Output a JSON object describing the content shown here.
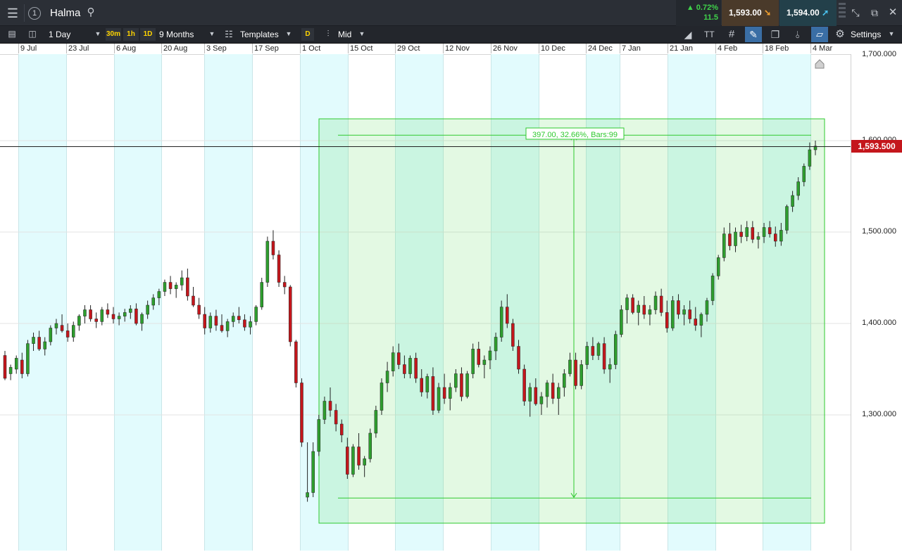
{
  "header": {
    "instrument": "Halma",
    "change_pct": "▲ 0.72%",
    "change_abs": "11.5",
    "sell_price": "1,593.00",
    "buy_price": "1,594.00",
    "sell_arrow": "➘",
    "buy_arrow": "➚"
  },
  "toolbar": {
    "interval": "1 Day",
    "quick_intervals": [
      "30m",
      "1h",
      "1D"
    ],
    "range": "9 Months",
    "templates": "Templates",
    "price_type_badge": "D",
    "price_type": "Mid",
    "font_tool": "TT",
    "settings": "Settings"
  },
  "x_axis": {
    "dates": [
      "9 Jul",
      "23 Jul",
      "6 Aug",
      "20 Aug",
      "3 Sep",
      "17 Sep",
      "1 Oct",
      "15 Oct",
      "29 Oct",
      "12 Nov",
      "26 Nov",
      "10 Dec",
      "24 Dec",
      "7 Jan",
      "21 Jan",
      "4 Feb",
      "18 Feb",
      "4 Mar"
    ]
  },
  "y_axis": {
    "labels": [
      "1,700.000",
      "1,600.000",
      "1,500.000",
      "1,400.000",
      "1,300.000"
    ],
    "values": [
      1700,
      1600,
      1500,
      1400,
      1300
    ],
    "current_price": "1,593.500",
    "current_value": 1593.5
  },
  "measure": {
    "label": "397.00, 32.66%, Bars:99",
    "from_price": 1209,
    "to_price": 1606
  },
  "chart_data": {
    "type": "candlestick",
    "up_color": "#2e9e2e",
    "down_color": "#c4161c",
    "x_labels": [
      "9 Jul",
      "23 Jul",
      "6 Aug",
      "20 Aug",
      "3 Sep",
      "17 Sep",
      "1 Oct",
      "15 Oct",
      "29 Oct",
      "12 Nov",
      "26 Nov",
      "10 Dec",
      "24 Dec",
      "7 Jan",
      "21 Jan",
      "4 Feb",
      "18 Feb",
      "4 Mar"
    ],
    "y_range": [
      1150,
      1700
    ],
    "series": [
      {
        "values_ohlc": [
          [
            1365,
            1370,
            1338,
            1340
          ],
          [
            1345,
            1355,
            1338,
            1352
          ],
          [
            1350,
            1365,
            1345,
            1362
          ],
          [
            1360,
            1368,
            1340,
            1345
          ],
          [
            1345,
            1382,
            1342,
            1378
          ],
          [
            1378,
            1390,
            1370,
            1385
          ],
          [
            1385,
            1392,
            1370,
            1372
          ],
          [
            1372,
            1385,
            1365,
            1380
          ],
          [
            1380,
            1398,
            1376,
            1395
          ],
          [
            1395,
            1405,
            1388,
            1400
          ],
          [
            1398,
            1410,
            1390,
            1392
          ],
          [
            1392,
            1400,
            1380,
            1385
          ],
          [
            1385,
            1402,
            1380,
            1398
          ],
          [
            1398,
            1410,
            1392,
            1408
          ],
          [
            1408,
            1420,
            1400,
            1415
          ],
          [
            1415,
            1420,
            1402,
            1405
          ],
          [
            1405,
            1412,
            1395,
            1402
          ],
          [
            1402,
            1418,
            1398,
            1415
          ],
          [
            1415,
            1422,
            1406,
            1410
          ],
          [
            1410,
            1418,
            1400,
            1405
          ],
          [
            1405,
            1412,
            1398,
            1408
          ],
          [
            1408,
            1416,
            1402,
            1412
          ],
          [
            1412,
            1420,
            1405,
            1416
          ],
          [
            1416,
            1422,
            1398,
            1400
          ],
          [
            1400,
            1412,
            1392,
            1410
          ],
          [
            1410,
            1425,
            1405,
            1420
          ],
          [
            1420,
            1432,
            1415,
            1428
          ],
          [
            1428,
            1438,
            1420,
            1435
          ],
          [
            1435,
            1448,
            1430,
            1445
          ],
          [
            1445,
            1452,
            1432,
            1438
          ],
          [
            1438,
            1445,
            1428,
            1442
          ],
          [
            1442,
            1458,
            1436,
            1450
          ],
          [
            1450,
            1460,
            1425,
            1430
          ],
          [
            1430,
            1440,
            1418,
            1420
          ],
          [
            1420,
            1428,
            1405,
            1410
          ],
          [
            1410,
            1418,
            1388,
            1395
          ],
          [
            1395,
            1412,
            1390,
            1408
          ],
          [
            1408,
            1415,
            1392,
            1398
          ],
          [
            1398,
            1410,
            1390,
            1392
          ],
          [
            1392,
            1405,
            1385,
            1402
          ],
          [
            1402,
            1412,
            1396,
            1408
          ],
          [
            1408,
            1418,
            1400,
            1404
          ],
          [
            1404,
            1410,
            1392,
            1396
          ],
          [
            1396,
            1408,
            1388,
            1402
          ],
          [
            1402,
            1420,
            1398,
            1418
          ],
          [
            1418,
            1450,
            1415,
            1445
          ],
          [
            1445,
            1495,
            1440,
            1490
          ],
          [
            1490,
            1502,
            1470,
            1475
          ],
          [
            1475,
            1480,
            1440,
            1445
          ],
          [
            1445,
            1452,
            1432,
            1440
          ],
          [
            1440,
            1442,
            1375,
            1380
          ],
          [
            1380,
            1382,
            1330,
            1335
          ],
          [
            1335,
            1340,
            1265,
            1270
          ],
          [
            1210,
            1270,
            1205,
            1215
          ],
          [
            1215,
            1270,
            1210,
            1260
          ],
          [
            1260,
            1300,
            1255,
            1295
          ],
          [
            1295,
            1320,
            1290,
            1315
          ],
          [
            1315,
            1330,
            1298,
            1305
          ],
          [
            1305,
            1312,
            1282,
            1290
          ],
          [
            1290,
            1295,
            1270,
            1278
          ],
          [
            1265,
            1275,
            1230,
            1235
          ],
          [
            1235,
            1268,
            1232,
            1265
          ],
          [
            1265,
            1280,
            1240,
            1245
          ],
          [
            1245,
            1255,
            1232,
            1252
          ],
          [
            1252,
            1285,
            1248,
            1280
          ],
          [
            1280,
            1310,
            1275,
            1305
          ],
          [
            1305,
            1340,
            1300,
            1335
          ],
          [
            1335,
            1358,
            1325,
            1348
          ],
          [
            1348,
            1375,
            1342,
            1368
          ],
          [
            1368,
            1378,
            1350,
            1355
          ],
          [
            1355,
            1365,
            1340,
            1345
          ],
          [
            1345,
            1365,
            1340,
            1362
          ],
          [
            1362,
            1368,
            1335,
            1340
          ],
          [
            1340,
            1350,
            1320,
            1325
          ],
          [
            1325,
            1345,
            1318,
            1342
          ],
          [
            1342,
            1352,
            1300,
            1305
          ],
          [
            1305,
            1335,
            1302,
            1330
          ],
          [
            1330,
            1345,
            1312,
            1318
          ],
          [
            1318,
            1335,
            1305,
            1330
          ],
          [
            1330,
            1350,
            1325,
            1345
          ],
          [
            1345,
            1352,
            1315,
            1320
          ],
          [
            1320,
            1348,
            1318,
            1345
          ],
          [
            1345,
            1378,
            1340,
            1372
          ],
          [
            1372,
            1380,
            1352,
            1355
          ],
          [
            1355,
            1365,
            1340,
            1360
          ],
          [
            1360,
            1375,
            1350,
            1370
          ],
          [
            1370,
            1390,
            1360,
            1385
          ],
          [
            1385,
            1425,
            1380,
            1418
          ],
          [
            1418,
            1432,
            1395,
            1400
          ],
          [
            1400,
            1405,
            1370,
            1375
          ],
          [
            1375,
            1382,
            1345,
            1350
          ],
          [
            1350,
            1355,
            1310,
            1315
          ],
          [
            1315,
            1335,
            1298,
            1330
          ],
          [
            1330,
            1340,
            1310,
            1312
          ],
          [
            1312,
            1325,
            1300,
            1320
          ],
          [
            1320,
            1338,
            1308,
            1335
          ],
          [
            1335,
            1345,
            1312,
            1318
          ],
          [
            1318,
            1335,
            1300,
            1330
          ],
          [
            1330,
            1350,
            1320,
            1345
          ],
          [
            1345,
            1368,
            1342,
            1360
          ],
          [
            1360,
            1368,
            1328,
            1332
          ],
          [
            1332,
            1360,
            1328,
            1355
          ],
          [
            1355,
            1380,
            1350,
            1375
          ],
          [
            1375,
            1385,
            1360,
            1365
          ],
          [
            1365,
            1380,
            1360,
            1378
          ],
          [
            1378,
            1385,
            1345,
            1350
          ],
          [
            1350,
            1362,
            1335,
            1355
          ],
          [
            1355,
            1392,
            1350,
            1388
          ],
          [
            1388,
            1420,
            1385,
            1415
          ],
          [
            1415,
            1432,
            1400,
            1428
          ],
          [
            1428,
            1432,
            1410,
            1412
          ],
          [
            1412,
            1425,
            1398,
            1420
          ],
          [
            1420,
            1430,
            1405,
            1410
          ],
          [
            1410,
            1420,
            1398,
            1415
          ],
          [
            1415,
            1435,
            1410,
            1430
          ],
          [
            1430,
            1438,
            1408,
            1412
          ],
          [
            1412,
            1425,
            1390,
            1395
          ],
          [
            1395,
            1430,
            1392,
            1425
          ],
          [
            1425,
            1432,
            1405,
            1410
          ],
          [
            1410,
            1420,
            1398,
            1415
          ],
          [
            1415,
            1425,
            1400,
            1405
          ],
          [
            1405,
            1418,
            1392,
            1398
          ],
          [
            1398,
            1412,
            1385,
            1410
          ],
          [
            1410,
            1428,
            1402,
            1425
          ],
          [
            1425,
            1455,
            1420,
            1452
          ],
          [
            1452,
            1475,
            1448,
            1472
          ],
          [
            1472,
            1505,
            1468,
            1498
          ],
          [
            1498,
            1510,
            1480,
            1485
          ],
          [
            1485,
            1505,
            1478,
            1500
          ],
          [
            1500,
            1508,
            1488,
            1495
          ],
          [
            1495,
            1512,
            1490,
            1505
          ],
          [
            1505,
            1512,
            1488,
            1492
          ],
          [
            1492,
            1500,
            1482,
            1495
          ],
          [
            1495,
            1510,
            1488,
            1505
          ],
          [
            1505,
            1512,
            1494,
            1498
          ],
          [
            1498,
            1506,
            1484,
            1490
          ],
          [
            1490,
            1510,
            1485,
            1502
          ],
          [
            1502,
            1530,
            1498,
            1528
          ],
          [
            1528,
            1545,
            1522,
            1540
          ],
          [
            1540,
            1560,
            1535,
            1555
          ],
          [
            1555,
            1575,
            1550,
            1572
          ],
          [
            1572,
            1598,
            1568,
            1590
          ],
          [
            1590,
            1600,
            1584,
            1594
          ]
        ]
      }
    ]
  }
}
